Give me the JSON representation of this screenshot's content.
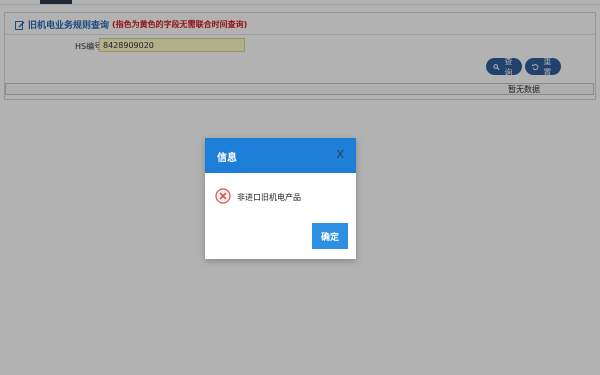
{
  "panel": {
    "title": "旧机电业务规则查询",
    "title_note": "(指色为黄色的字段无需联合时间查询)",
    "hs_label": "HS编号",
    "hs_value": "8428909020",
    "query_button": "查询",
    "reset_button": "重置",
    "no_data_text": "暂无数据"
  },
  "dialog": {
    "title": "信息",
    "close_symbol": "X",
    "message": "非进口旧机电产品",
    "ok_button": "确定",
    "icon": "error-x-icon"
  },
  "colors": {
    "accent": "#1e7fd8",
    "button": "#2f5f9c",
    "error": "#d9534f",
    "highlight_field": "#fefbc9"
  }
}
